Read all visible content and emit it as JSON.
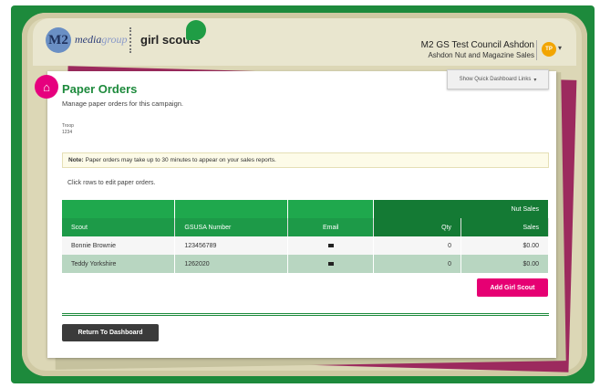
{
  "header": {
    "logo_m2": "M2",
    "logo_media": "media",
    "logo_group": "group",
    "logo_gs": "girl scouts",
    "council_name": "M2 GS Test Council Ashdon",
    "council_sub": "Ashdon Nut and Magazine Sales",
    "avatar_initials": "TP",
    "avatar_color": "#f2a500"
  },
  "quick_links_label": "Show Quick Dashboard Links",
  "page": {
    "title": "Paper Orders",
    "subtitle": "Manage paper orders for this campaign.",
    "troop_label": "Troop",
    "troop_value": "1234",
    "note_label": "Note:",
    "note_text": "Paper orders may take up to 30 minutes to appear on your sales reports.",
    "click_hint": "Click rows to edit paper orders."
  },
  "table": {
    "group_header": "Nut Sales",
    "columns": [
      "Scout",
      "GSUSA Number",
      "Email",
      "Qty",
      "Sales"
    ],
    "rows": [
      {
        "scout": "Bonnie Brownie",
        "gsusa": "123456789",
        "qty": "0",
        "sales": "$0.00"
      },
      {
        "scout": "Teddy Yorkshire",
        "gsusa": "1262020",
        "qty": "0",
        "sales": "$0.00"
      }
    ]
  },
  "buttons": {
    "add_scout": "Add Girl Scout",
    "return": "Return To Dashboard"
  },
  "colors": {
    "brand_green": "#1d8a3c",
    "accent_pink": "#e60073"
  }
}
